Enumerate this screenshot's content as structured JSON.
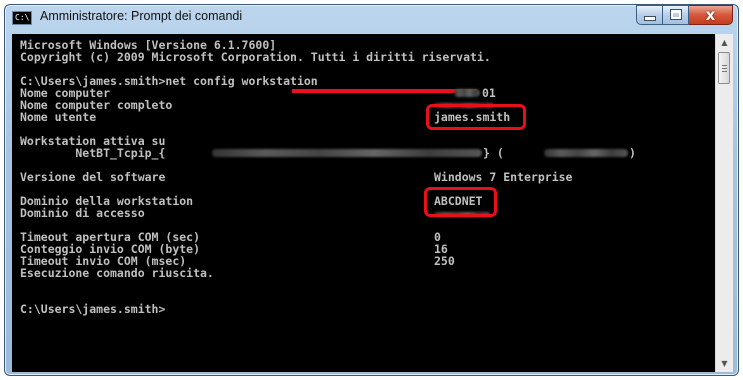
{
  "window": {
    "title": "Amministratore: Prompt dei comandi",
    "app_icon_text": "C:\\",
    "controls": {
      "close_glyph": "x"
    }
  },
  "console": {
    "header_lines": [
      "Microsoft Windows [Versione 6.1.7600]",
      "Copyright (c) 2009 Microsoft Corporation. Tutti i diritti riservati."
    ],
    "command_line": "C:\\Users\\james.smith>net config workstation",
    "labels": {
      "computer_name": "Nome computer",
      "full_computer_name": "Nome computer completo",
      "user_name": "Nome utente",
      "active_workstation": "Workstation attiva su",
      "netbt": "        NetBT_Tcpip_{",
      "software_version": "Versione del software",
      "workstation_domain": "Dominio della workstation",
      "logon_domain": "Dominio di accesso",
      "com_open_timeout": "Timeout apertura COM (sec)",
      "com_send_count": "Conteggio invio COM (byte)",
      "com_send_timeout": "Timeout invio COM (msec)",
      "success": "Esecuzione comando riuscita."
    },
    "values": {
      "computer_name_partial": "01",
      "user_name": "james.smith",
      "software_version": "Windows 7 Enterprise",
      "workstation_domain": "ABCDNET",
      "com_open_timeout": "0",
      "com_send_count": "16",
      "com_send_timeout": "250"
    },
    "netbt_middle": "} (",
    "netbt_end": ")",
    "prompt": "C:\\Users\\james.smith>"
  },
  "colors": {
    "console_bg": "#000000",
    "console_text": "#c0c0c0",
    "highlight": "#e8101a"
  }
}
